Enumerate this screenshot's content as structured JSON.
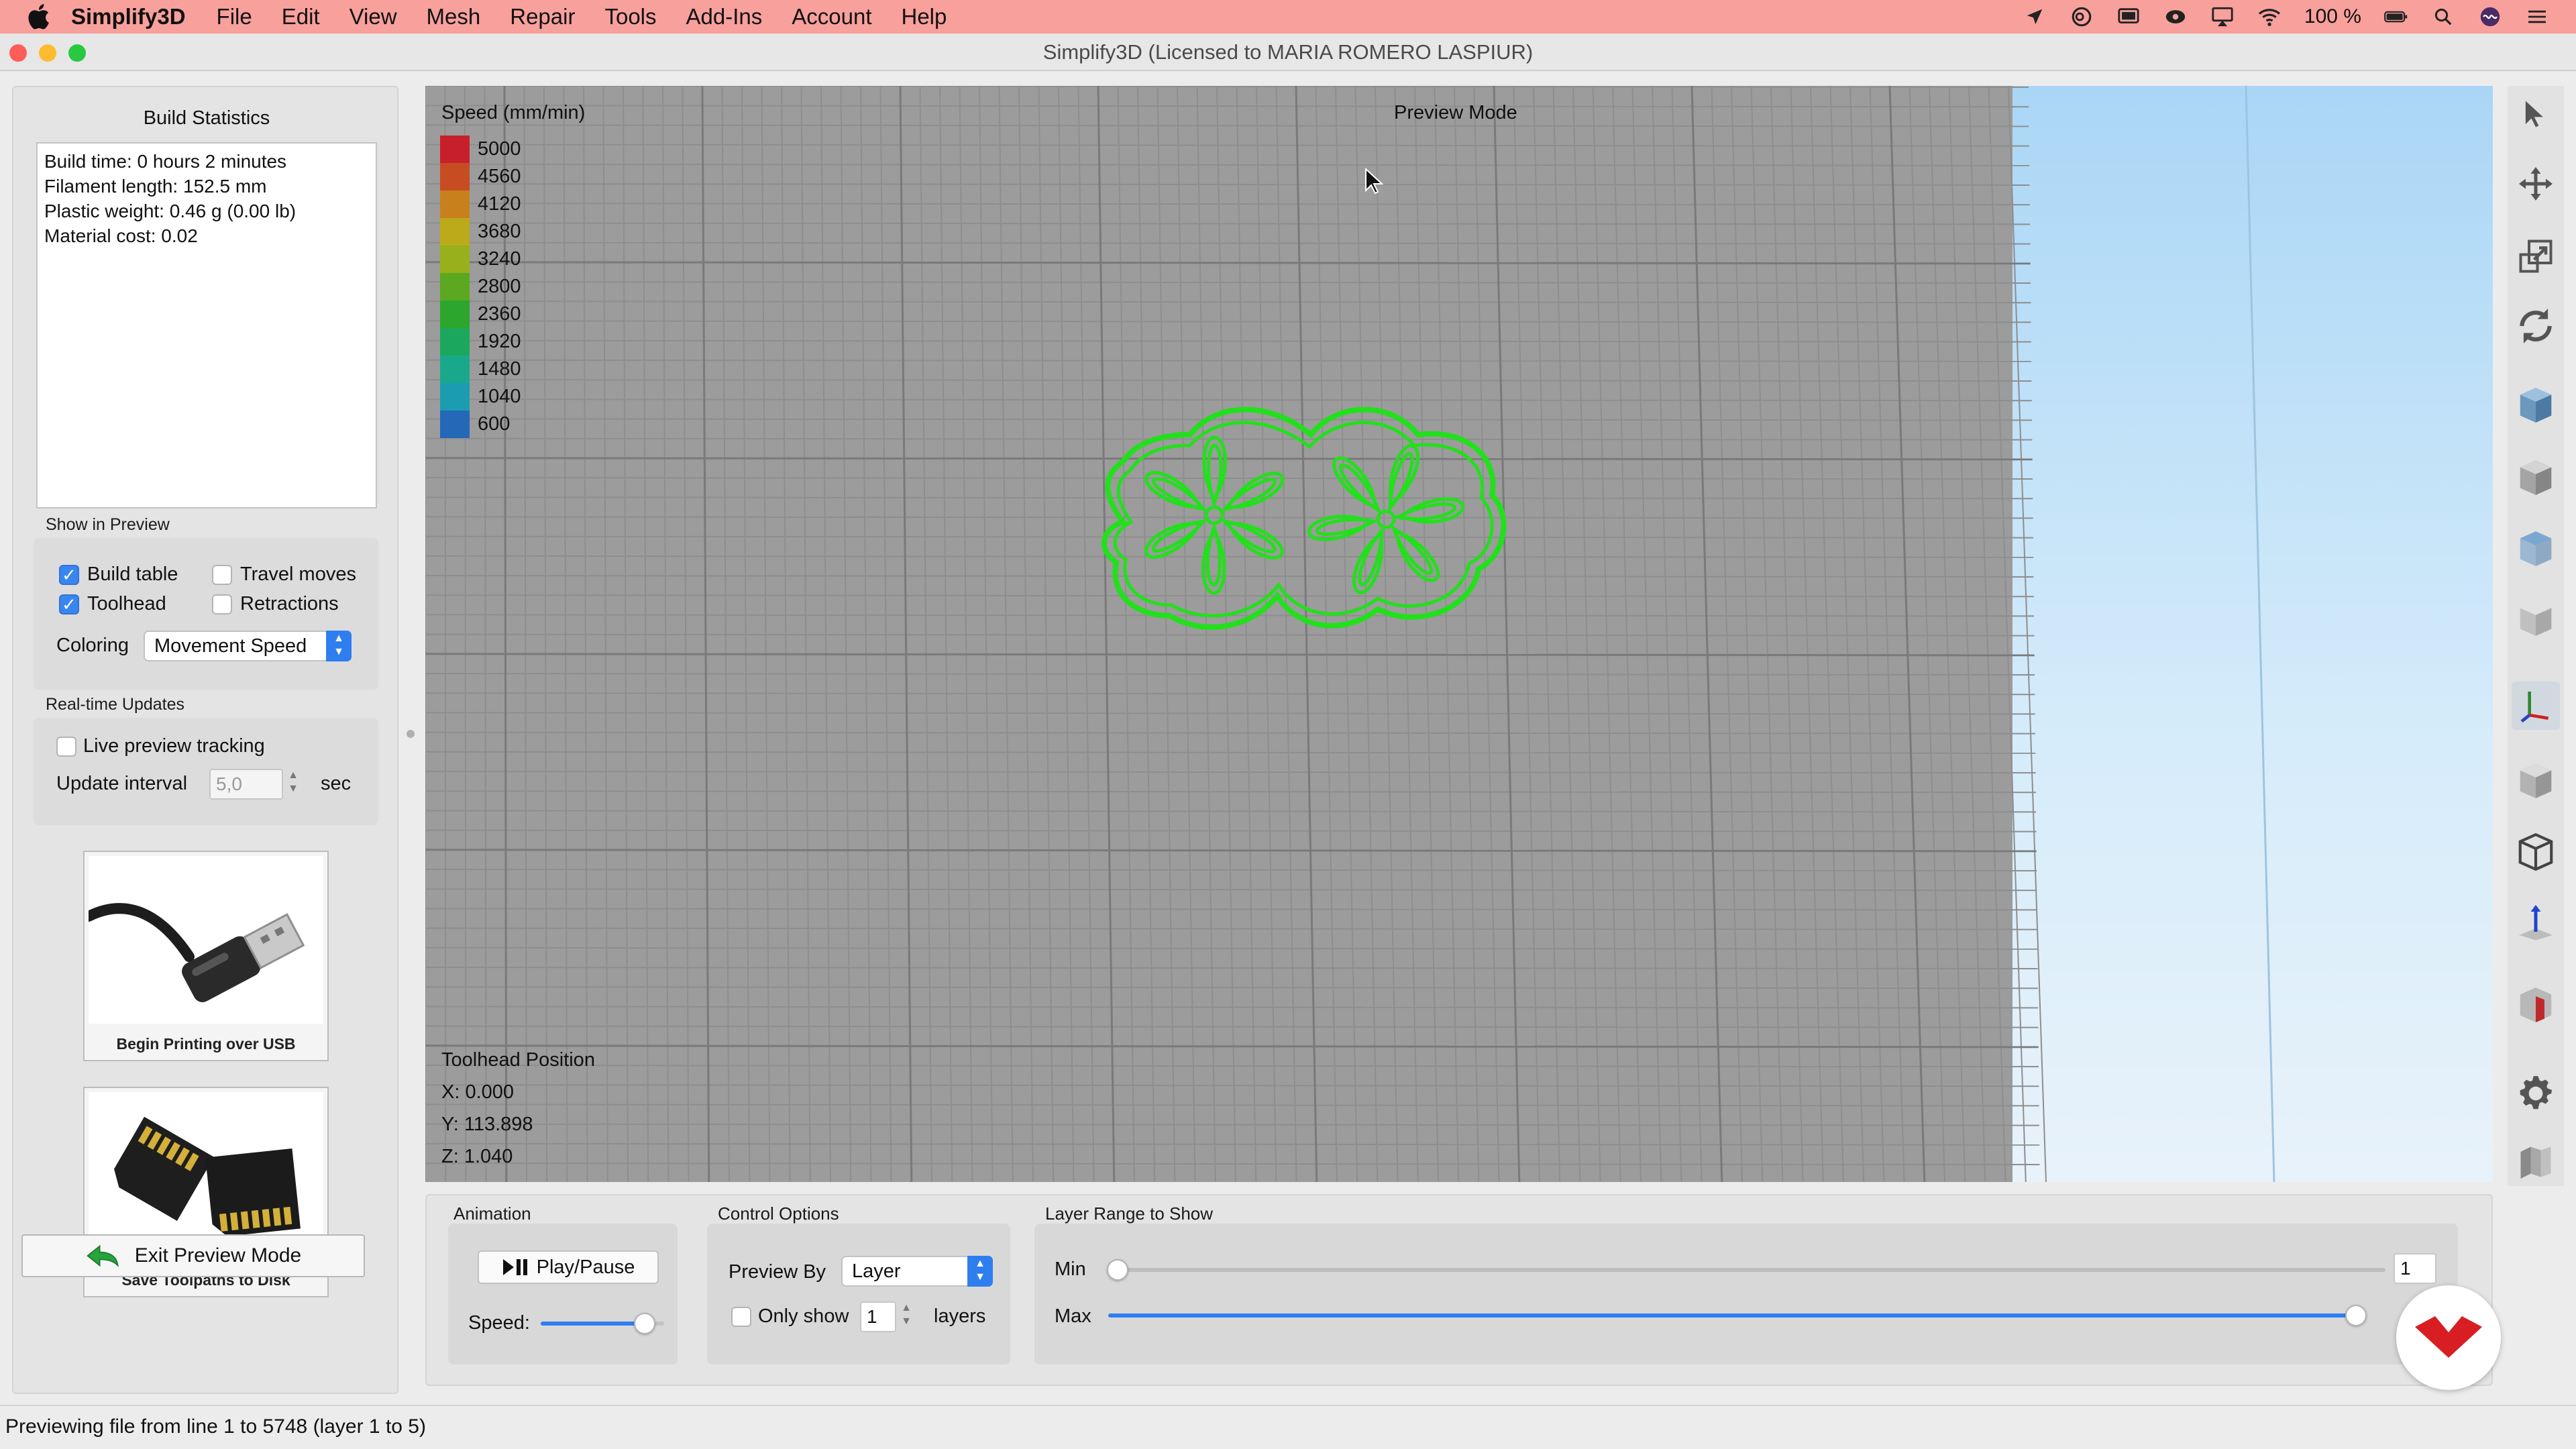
{
  "menubar": {
    "app_name": "Simplify3D",
    "items": [
      "File",
      "Edit",
      "View",
      "Mesh",
      "Repair",
      "Tools",
      "Add-Ins",
      "Account",
      "Help"
    ],
    "battery": "100 %"
  },
  "window": {
    "title": "Simplify3D (Licensed to MARIA ROMERO LASPIUR)"
  },
  "build_statistics": {
    "heading": "Build Statistics",
    "lines": [
      "Build time: 0 hours 2 minutes",
      "Filament length: 152.5 mm",
      "Plastic weight: 0.46 g (0.00 lb)",
      "Material cost: 0.02"
    ]
  },
  "show_in_preview": {
    "label": "Show in Preview",
    "build_table": {
      "label": "Build table",
      "checked": true
    },
    "travel_moves": {
      "label": "Travel moves",
      "checked": false
    },
    "toolhead": {
      "label": "Toolhead",
      "checked": true
    },
    "retractions": {
      "label": "Retractions",
      "checked": false
    },
    "coloring_label": "Coloring",
    "coloring_value": "Movement Speed"
  },
  "realtime_updates": {
    "label": "Real-time Updates",
    "live_tracking": {
      "label": "Live preview tracking",
      "checked": false
    },
    "interval_label": "Update interval",
    "interval_value": "5,0",
    "interval_unit": "sec"
  },
  "tiles": {
    "usb": "Begin Printing over USB",
    "disk": "Save Toolpaths to Disk"
  },
  "exit_button": "Exit Preview Mode",
  "viewport": {
    "legend_title": "Speed (mm/min)",
    "mode_label": "Preview Mode",
    "legend": [
      {
        "value": "5000",
        "color": "#c8202a"
      },
      {
        "value": "4560",
        "color": "#c84c22"
      },
      {
        "value": "4120",
        "color": "#c8801c"
      },
      {
        "value": "3680",
        "color": "#bcaa1a"
      },
      {
        "value": "3240",
        "color": "#98b01c"
      },
      {
        "value": "2800",
        "color": "#5ca820"
      },
      {
        "value": "2360",
        "color": "#2ca62c"
      },
      {
        "value": "1920",
        "color": "#1ca85c"
      },
      {
        "value": "1480",
        "color": "#1aa88c"
      },
      {
        "value": "1040",
        "color": "#1c9cb0"
      },
      {
        "value": "600",
        "color": "#2468b8"
      }
    ],
    "toolhead_title": "Toolhead Position",
    "x": "X: 0.000",
    "y": "Y: 113.898",
    "z": "Z: 1.040"
  },
  "animation": {
    "title": "Animation",
    "play_pause": "Play/Pause",
    "speed_label": "Speed:",
    "speed_fraction": 0.84
  },
  "control_options": {
    "title": "Control Options",
    "preview_by_label": "Preview By",
    "preview_by_value": "Layer",
    "only_show_label": "Only show",
    "only_show_value": "1",
    "layers_label": "layers",
    "only_show_checked": false
  },
  "layer_range": {
    "title": "Layer Range to Show",
    "min_label": "Min",
    "max_label": "Max",
    "min_value": "1",
    "min_fraction": 0.0,
    "max_fraction": 1.0
  },
  "status_bar": "Previewing file from line 1 to 5748 (layer 1 to 5)",
  "colors": {
    "menubar": "#f8a09c",
    "accent": "#2f7ef0",
    "toolpath": "#22e01c",
    "viewport_bg": "#9c9c9c",
    "logo_red": "#d81e22"
  }
}
